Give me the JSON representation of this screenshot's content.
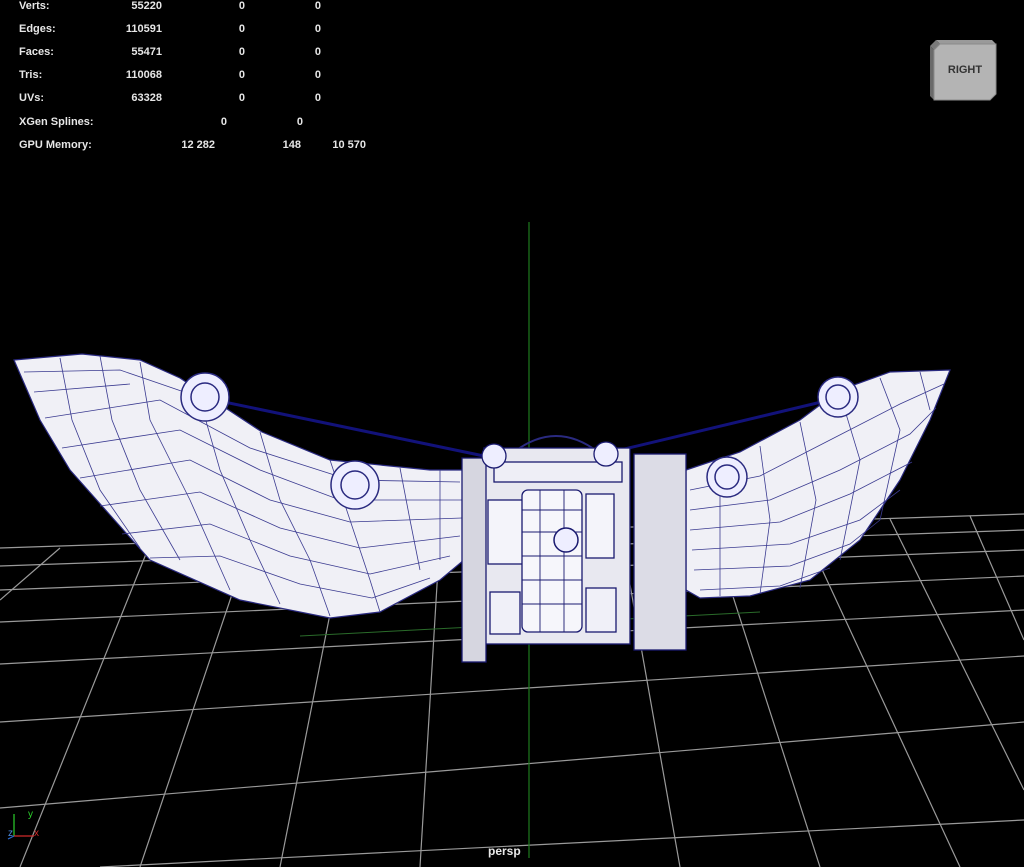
{
  "hud": {
    "rows": [
      {
        "label": "Verts:",
        "values": [
          "55220",
          "0",
          "0"
        ]
      },
      {
        "label": "Edges:",
        "values": [
          "110591",
          "0",
          "0"
        ]
      },
      {
        "label": "Faces:",
        "values": [
          "55471",
          "0",
          "0"
        ]
      },
      {
        "label": "Tris:",
        "values": [
          "110068",
          "0",
          "0"
        ]
      },
      {
        "label": "UVs:",
        "values": [
          "63328",
          "0",
          "0"
        ]
      },
      {
        "label": "XGen Splines:",
        "values": [
          "0",
          "0"
        ]
      },
      {
        "label": "GPU Memory:",
        "values": [
          "12 282",
          "148",
          "10 570"
        ]
      }
    ]
  },
  "viewcube": {
    "face_label": "RIGHT"
  },
  "camera": {
    "label": "persp"
  },
  "axis_gizmo": {
    "x": "x",
    "y": "y",
    "z": "z"
  },
  "colors": {
    "background": "#000000",
    "grid": "#bdbdbd",
    "wireframe": "#1a1a80",
    "mesh_fill": "#f0f0f8",
    "y_axis": "#2bd02b",
    "x_axis": "#d02b2b",
    "z_axis": "#2b6bd0"
  }
}
